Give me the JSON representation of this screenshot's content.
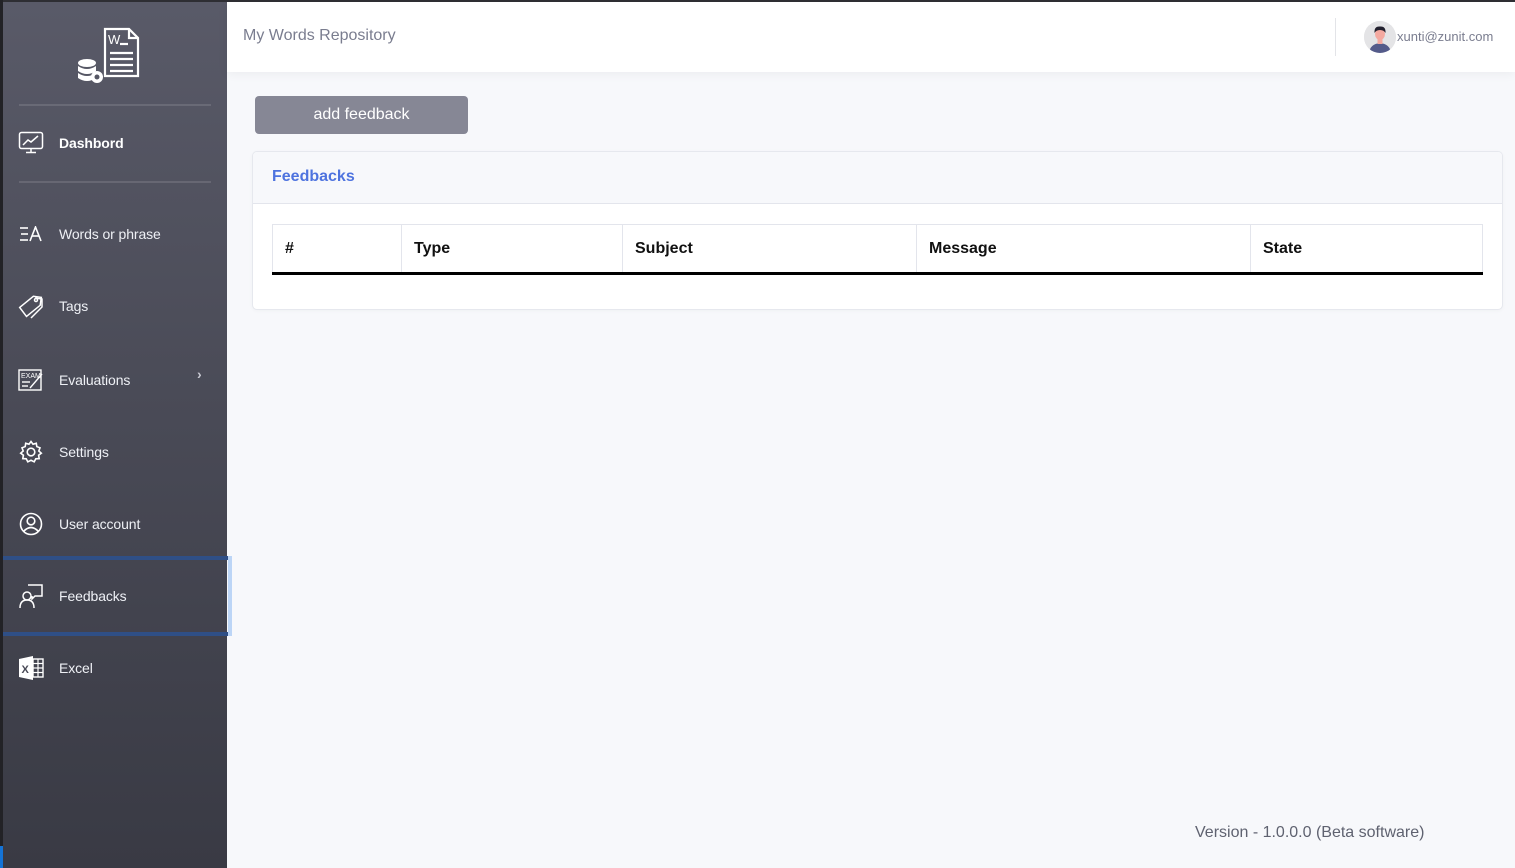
{
  "app": {
    "title": "My Words Repository"
  },
  "user": {
    "email": "xunti@zunit.com",
    "avatar_icon": "user-avatar"
  },
  "sidebar": {
    "logo_icon": "word-database-logo",
    "items": [
      {
        "label": "Dashbord",
        "icon": "monitor-chart-icon",
        "active": false
      },
      {
        "label": "Words or phrase",
        "icon": "text-lines-icon",
        "active": false
      },
      {
        "label": "Tags",
        "icon": "tags-icon",
        "active": false
      },
      {
        "label": "Evaluations",
        "icon": "exam-icon",
        "active": false,
        "has_submenu": true,
        "chevron": "›"
      },
      {
        "label": "Settings",
        "icon": "gear-icon",
        "active": false
      },
      {
        "label": "User account",
        "icon": "user-circle-icon",
        "active": false
      },
      {
        "label": "Feedbacks",
        "icon": "presenter-icon",
        "active": true
      },
      {
        "label": "Excel",
        "icon": "excel-icon",
        "active": false
      }
    ]
  },
  "toolbar": {
    "add_feedback_label": "add feedback"
  },
  "feedbacks_card": {
    "title": "Feedbacks",
    "columns": [
      "#",
      "Type",
      "Subject",
      "Message",
      "State"
    ],
    "rows": []
  },
  "footer": {
    "version": "Version - 1.0.0.0 (Beta software)"
  },
  "colors": {
    "accent": "#4e73df",
    "button": "#868795",
    "active_border": "#2f4f86",
    "active_edge": "#bcd5f6"
  }
}
